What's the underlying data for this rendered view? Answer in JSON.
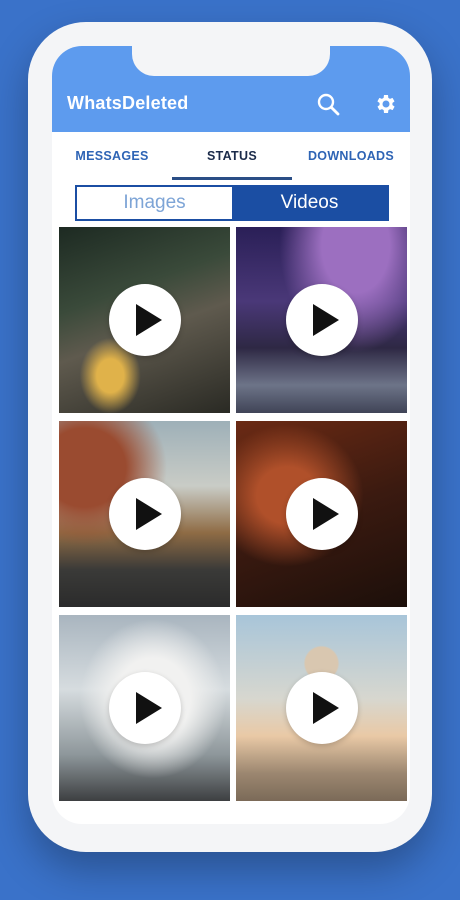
{
  "app": {
    "title": "WhatsDeleted"
  },
  "toolbar": {
    "search_icon": "search-icon",
    "settings_icon": "gear-icon"
  },
  "tabs": [
    {
      "label": "MESSAGES",
      "active": false
    },
    {
      "label": "STATUS",
      "active": true
    },
    {
      "label": "DOWNLOADS",
      "active": false
    }
  ],
  "media_toggle": {
    "options": [
      "Images",
      "Videos"
    ],
    "selected": "Videos"
  },
  "videos": [
    {
      "thumbnail": "stone house in forest"
    },
    {
      "thumbnail": "starry night over rocky river"
    },
    {
      "thumbnail": "motorcycle on desert road"
    },
    {
      "thumbnail": "lion face close-up"
    },
    {
      "thumbnail": "crashing ocean wave"
    },
    {
      "thumbnail": "hot air balloon over valley"
    }
  ],
  "colors": {
    "background": "#3a72c9",
    "appbar": "#5d9bee",
    "accent": "#1b4ea3"
  }
}
